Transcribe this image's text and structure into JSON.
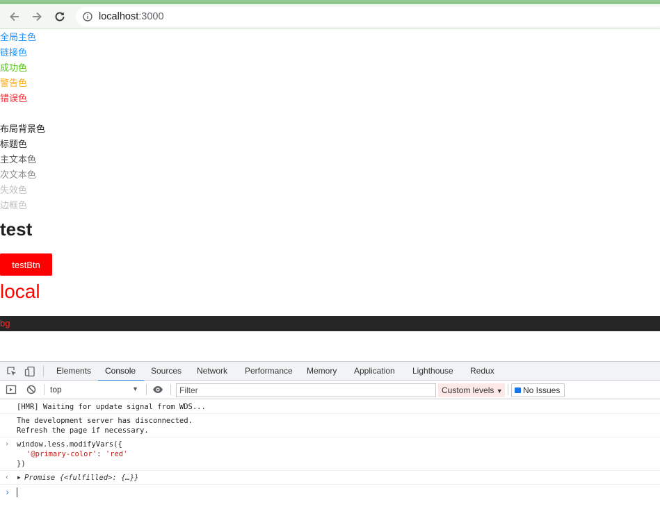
{
  "browser": {
    "url_host": "localhost",
    "url_port": ":3000"
  },
  "page": {
    "color_lines": [
      {
        "label": "全局主色",
        "color": "#1890ff"
      },
      {
        "label": "链接色",
        "color": "#1890ff"
      },
      {
        "label": "成功色",
        "color": "#52c41a"
      },
      {
        "label": "警告色",
        "color": "#faad14"
      },
      {
        "label": "错误色",
        "color": "#f5222d"
      }
    ],
    "text_lines": [
      {
        "label": "布局背景色",
        "color": "#222222"
      },
      {
        "label": "标题色",
        "color": "#262626"
      },
      {
        "label": "主文本色",
        "color": "#595959"
      },
      {
        "label": "次文本色",
        "color": "#8c8c8c"
      },
      {
        "label": "失效色",
        "color": "#bfbfbf"
      },
      {
        "label": "边框色",
        "color": "#bfbfbf"
      }
    ],
    "heading": "test",
    "button_label": "testBtn",
    "local_text": "local",
    "bg_text": "bg",
    "accent_color": "#ff0000"
  },
  "devtools": {
    "tabs": [
      "Elements",
      "Console",
      "Sources",
      "Network",
      "Performance",
      "Memory",
      "Application",
      "Lighthouse",
      "Redux"
    ],
    "active_tab": "Console",
    "context": "top",
    "filter_placeholder": "Filter",
    "levels_label": "Custom levels",
    "issues_label": "No Issues",
    "messages": {
      "hmr": "[HMR] Waiting for update signal from WDS...",
      "disconnect_1": "The development server has disconnected.",
      "disconnect_2": "Refresh the page if necessary.",
      "input_1": "window.less.modifyVars({",
      "input_2_key": "'@primary-color'",
      "input_2_sep": ": ",
      "input_2_val": "'red'",
      "input_3": "})",
      "result": "Promise {<fulfilled>: {…}}"
    }
  }
}
